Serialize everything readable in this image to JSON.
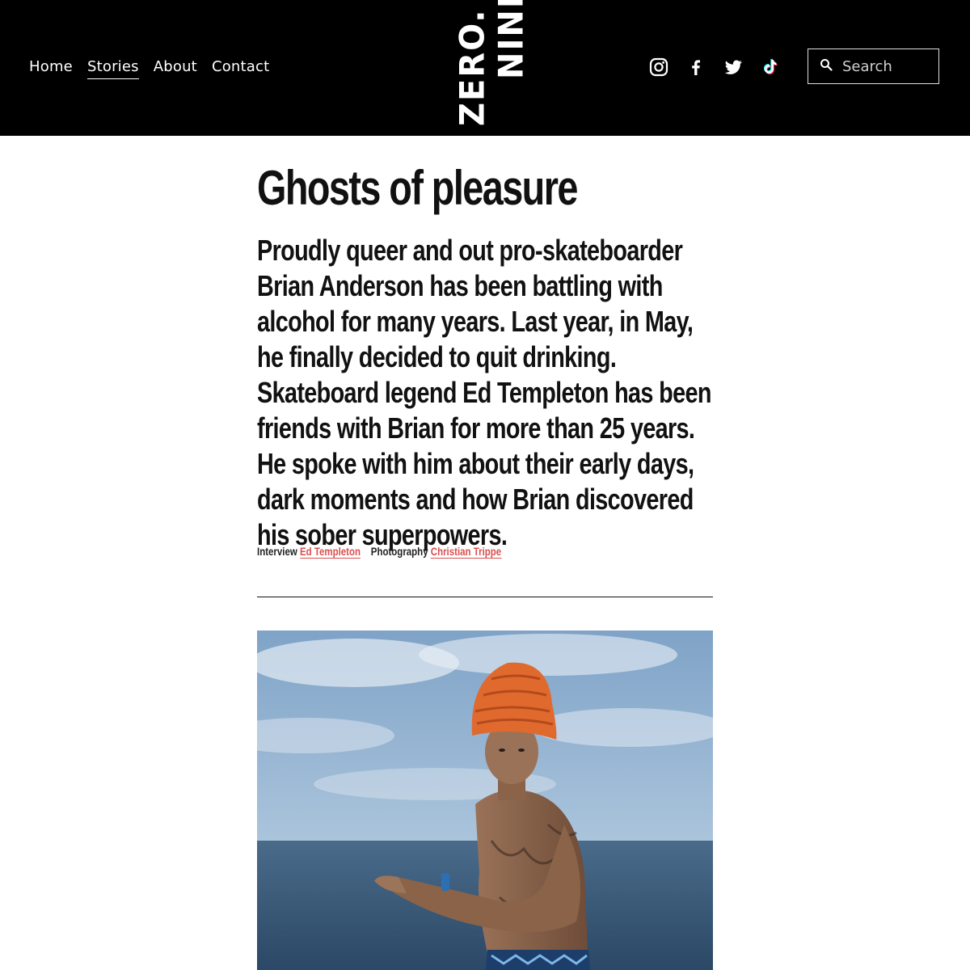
{
  "header": {
    "nav": [
      {
        "label": "Home"
      },
      {
        "label": "Stories",
        "active": true
      },
      {
        "label": "About"
      },
      {
        "label": "Contact"
      }
    ],
    "logo": {
      "line1": "ZERO.",
      "line2": "NINE"
    },
    "social": [
      "instagram-icon",
      "facebook-icon",
      "twitter-icon",
      "tiktok-icon"
    ],
    "search": {
      "placeholder": "Search"
    }
  },
  "article": {
    "title": "Ghosts of pleasure",
    "dek": "Proudly queer and out pro-skateboarder Brian Anderson has been battling with alcohol for many years. Last year, in May, he finally decided to quit drinking. Skateboard legend Ed Templeton has been friends with Brian for more than 25 years. He spoke with him about their early days, dark moments and how Brian discovered his sober superpowers.",
    "credits": {
      "interview_label": "Interview",
      "interview_name": "Ed Templeton",
      "photography_label": "Photography",
      "photography_name": "Christian Trippe"
    }
  },
  "colors": {
    "header_bg": "#000000",
    "link_accent": "#d94f4f",
    "sky": "#8fb0cf",
    "sea": "#3f5f7d",
    "hat": "#e06a2e"
  }
}
